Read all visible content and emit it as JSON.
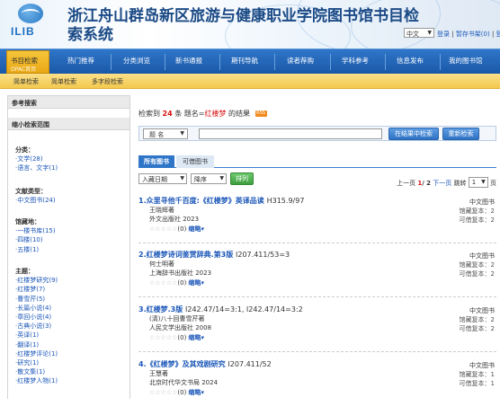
{
  "header": {
    "logo_text": "ILIB",
    "title": "浙江舟山群岛新区旅游与健康职业学院图书馆书目检索系统",
    "language": "中文",
    "links": [
      "登录",
      "暂存书架(0)",
      "登出"
    ]
  },
  "nav": {
    "active": {
      "label": "书目检索",
      "sublabel": "OPAC首页"
    },
    "items": [
      "热门推荐",
      "分类浏览",
      "新书通报",
      "期刊导航",
      "读者荐购",
      "学科参考",
      "信息发布",
      "我的图书馆"
    ]
  },
  "subnav": [
    "简单检索",
    "简单检索",
    "多字段检索"
  ],
  "sidebar": {
    "ref_title": "参考搜索",
    "narrow_title": "缩小检索范围",
    "groups": [
      {
        "title": "分类：",
        "items": [
          "·文学(28)",
          "·语言、文字(1)"
        ]
      },
      {
        "title": "文献类型：",
        "items": [
          "·中文图书(24)"
        ]
      },
      {
        "title": "馆藏地：",
        "items": [
          "·一楼书库(15)",
          "·四楼(10)",
          "·五楼(1)"
        ]
      },
      {
        "title": "主题：",
        "items": [
          "·红楼梦研究(9)",
          "·红楼梦(7)",
          "·曹雪芹(5)",
          "·长篇小说(4)",
          "·章回小说(4)",
          "·古典小说(3)",
          "·英译(1)",
          "·翻译(1)",
          "·红楼梦评论(1)",
          "·研究(1)",
          "·散文集(1)",
          "·红楼梦人物(1)"
        ]
      }
    ]
  },
  "results": {
    "prefix": "检索到",
    "count": "24",
    "middle": "条 题名=",
    "query": "红楼梦",
    "suffix": "的结果",
    "rss": "RSS",
    "field": "题  名",
    "query_value": "",
    "btn_in_results": "在结果中检索",
    "btn_research": "重新检索",
    "tabs": [
      "所有图书",
      "可借图书"
    ],
    "sort_field": "入藏日期",
    "sort_order": "降序",
    "sort_button": "排列",
    "pager_pre": "上一页",
    "pager_page": "1",
    "pager_total": "/ 2",
    "pager_next": "下一页",
    "pager_goto": "跳转",
    "pager_input": "1",
    "pager_unit": "页",
    "items": [
      {
        "title": "1.众里寻他千百度:《红楼梦》英译品读",
        "call": "H315.9/97",
        "author": "王晓辉著",
        "pub": "外文出版社 2023",
        "stars": "☆☆☆☆☆",
        "rating": "(0)",
        "brief": "缩略▾",
        "type": "中文图书",
        "copies": "馆藏复本：2",
        "avail": "可借复本：2"
      },
      {
        "title": "2.红楼梦诗词鉴赏辞典.第3版",
        "call": "I207.411/53=3",
        "author": "何士明著",
        "pub": "上海辞书出版社 2023",
        "stars": "☆☆☆☆☆",
        "rating": "(0)",
        "brief": "缩略▾",
        "type": "中文图书",
        "copies": "馆藏复本：2",
        "avail": "可借复本：2"
      },
      {
        "title": "3.红楼梦.3版",
        "call": "I242.47/14=3:1, I242.47/14=3:2",
        "author": "(清)八十回曹雪芹著",
        "pub": "人民文学出版社 2008",
        "stars": "☆☆☆☆☆",
        "rating": "(0)",
        "brief": "缩略▾",
        "type": "中文图书",
        "copies": "馆藏复本：2",
        "avail": "可借复本：2"
      },
      {
        "title": "4.《红楼梦》及其戏剧研究",
        "call": "I207.411/52",
        "author": "王慧著",
        "pub": "北京时代华文书局 2024",
        "stars": "☆☆☆☆☆",
        "rating": "(0)",
        "brief": "缩略▾",
        "type": "中文图书",
        "copies": "馆藏复本：1",
        "avail": "可借复本：1"
      }
    ]
  },
  "colors": {
    "nav": "#2a68b8",
    "active": "#f2b623",
    "subnav": "#f6d46a",
    "link": "#1a56b8",
    "highlight": "#d81010"
  }
}
